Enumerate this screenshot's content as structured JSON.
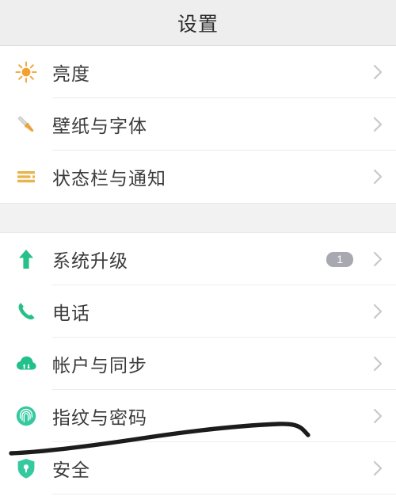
{
  "header": {
    "title": "设置"
  },
  "sections": [
    {
      "id": "display-section",
      "rows": [
        {
          "id": "brightness",
          "label": "亮度",
          "icon": "sun-icon",
          "icon_color": "#f2a22c",
          "badge": null,
          "chevron": "chevron-right-icon"
        },
        {
          "id": "wallpaper-and-fonts",
          "label": "壁纸与字体",
          "icon": "paintbrush-icon",
          "icon_color": "#e8a33d",
          "badge": null,
          "chevron": "chevron-right-icon"
        },
        {
          "id": "status-bar-and-notifications",
          "label": "状态栏与通知",
          "icon": "status-bar-lines-icon",
          "icon_color": "#e3b martial",
          "badge": null,
          "chevron": "chevron-right-icon"
        }
      ]
    },
    {
      "id": "system-section",
      "rows": [
        {
          "id": "system-update",
          "label": "系统升级",
          "icon": "arrow-up-icon",
          "icon_color": "#27c08a",
          "badge": "1",
          "chevron": "chevron-right-icon"
        },
        {
          "id": "phone",
          "label": "电话",
          "icon": "phone-icon",
          "icon_color": "#27c08a",
          "badge": null,
          "chevron": "chevron-right-icon"
        },
        {
          "id": "accounts-and-sync",
          "label": "帐户与同步",
          "icon": "cloud-sync-icon",
          "icon_color": "#22c08a",
          "badge": null,
          "chevron": "chevron-right-icon"
        },
        {
          "id": "fingerprint-and-password",
          "label": "指纹与密码",
          "icon": "fingerprint-icon",
          "icon_color": "#35c9a0",
          "badge": null,
          "chevron": "chevron-right-icon"
        },
        {
          "id": "security",
          "label": "安全",
          "icon": "shield-lock-icon",
          "icon_color": "#35c9a0",
          "badge": null,
          "chevron": "chevron-right-icon"
        }
      ]
    }
  ],
  "annotation": {
    "type": "hand-drawn-line",
    "color": "#1c1c1c"
  },
  "colors": {
    "header_bg": "#eeeeee",
    "row_bg": "#ffffff",
    "section_gap_bg": "#f2f2f2",
    "divider": "#ededed",
    "label_text": "#3a3a3a",
    "chevron": "#c8c8c8",
    "badge_bg": "#a8a8b0",
    "accent_orange": "#f2a22c",
    "accent_green": "#27c08a"
  }
}
